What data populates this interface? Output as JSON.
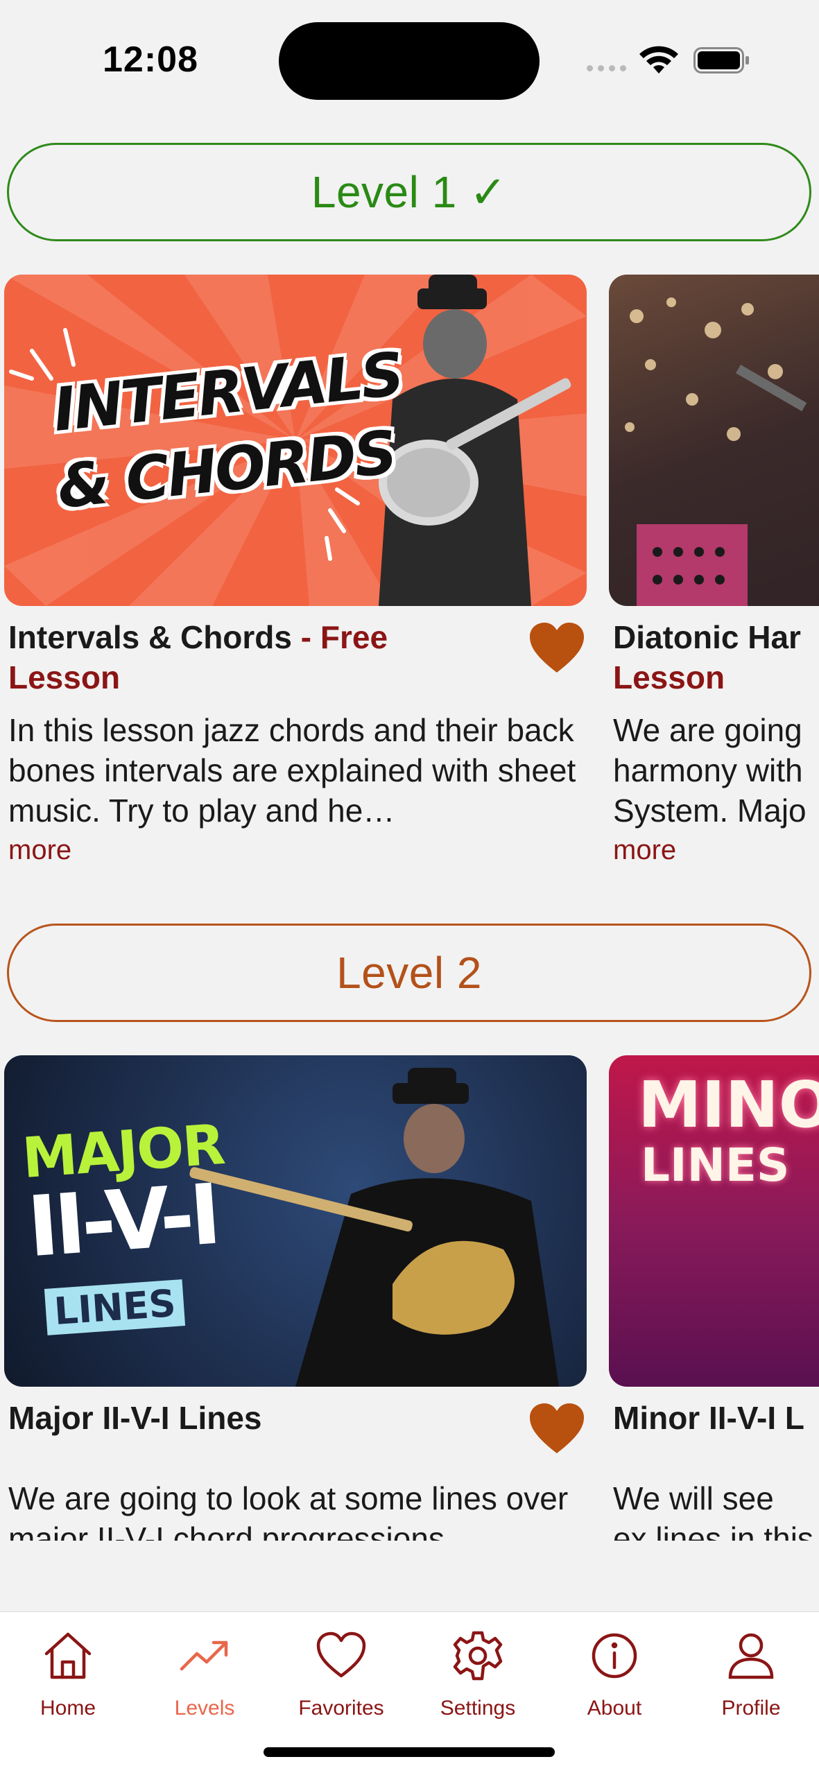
{
  "status_bar": {
    "time": "12:08"
  },
  "levels": [
    {
      "label": "Level 1 ✓",
      "lessons": [
        {
          "title": "Intervals & Chords",
          "tag": " - Free",
          "tag_line2": "Lesson",
          "description": "In this lesson jazz chords and their back bones intervals are explained with sheet music. Try to play and he…",
          "more": "more",
          "thumb_text_1": "INTERVALS",
          "thumb_text_2": "& CHORDS"
        },
        {
          "title": "Diatonic Har",
          "tag_line2": "Lesson",
          "description": "We are going harmony with System. Majo",
          "more": "more"
        }
      ]
    },
    {
      "label": "Level 2",
      "lessons": [
        {
          "title": "Major II-V-I Lines",
          "description": "We are going to look at some lines over major II-V-I chord progressions",
          "thumb_text_1": "MAJOR",
          "thumb_text_2": "II-V-I",
          "thumb_text_3": "LINES"
        },
        {
          "title": "Minor II-V-I L",
          "description": "We will see ex lines in this le",
          "thumb_text_1": "MINOR",
          "thumb_text_2": "LINES"
        }
      ]
    }
  ],
  "tab_bar": {
    "tabs": [
      {
        "label": "Home",
        "icon": "house-icon"
      },
      {
        "label": "Levels",
        "icon": "trend-up-icon",
        "active": true
      },
      {
        "label": "Favorites",
        "icon": "heart-icon"
      },
      {
        "label": "Settings",
        "icon": "gear-icon"
      },
      {
        "label": "About",
        "icon": "info-icon"
      },
      {
        "label": "Profile",
        "icon": "person-icon"
      }
    ]
  },
  "colors": {
    "accent": "#8b1515",
    "level1": "#2a8a14",
    "level2": "#b3511a",
    "heart": "#b8500f",
    "active_tab": "#e8664a"
  }
}
